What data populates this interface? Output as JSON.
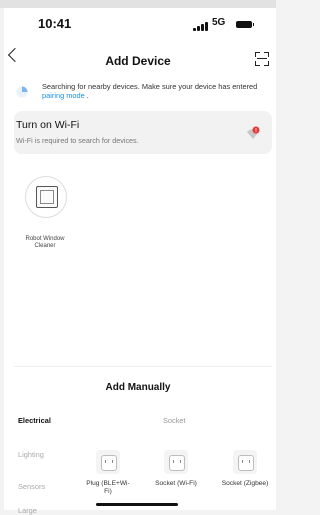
{
  "status": {
    "time": "10:41",
    "network": "5G"
  },
  "nav": {
    "title": "Add Device"
  },
  "searching": {
    "text": "Searching for nearby devices. Make sure your device has entered",
    "link": "pairing mode",
    "suffix": " ."
  },
  "wifi": {
    "title": "Turn on Wi-Fi",
    "subtitle": "Wi-Fi is required to search for devices."
  },
  "found_devices": [
    {
      "label": "Robot Window Cleaner"
    }
  ],
  "manual": {
    "title": "Add Manually",
    "categories": [
      "Electrical",
      "Lighting",
      "Sensors",
      "Large"
    ],
    "active_category": "Electrical",
    "section_header": "Socket",
    "items": [
      {
        "label": "Plug (BLE+Wi-Fi)"
      },
      {
        "label": "Socket (Wi-Fi)"
      },
      {
        "label": "Socket (Zigbee)"
      }
    ]
  },
  "colors": {
    "link": "#1d8fe8",
    "alert": "#e53935"
  }
}
